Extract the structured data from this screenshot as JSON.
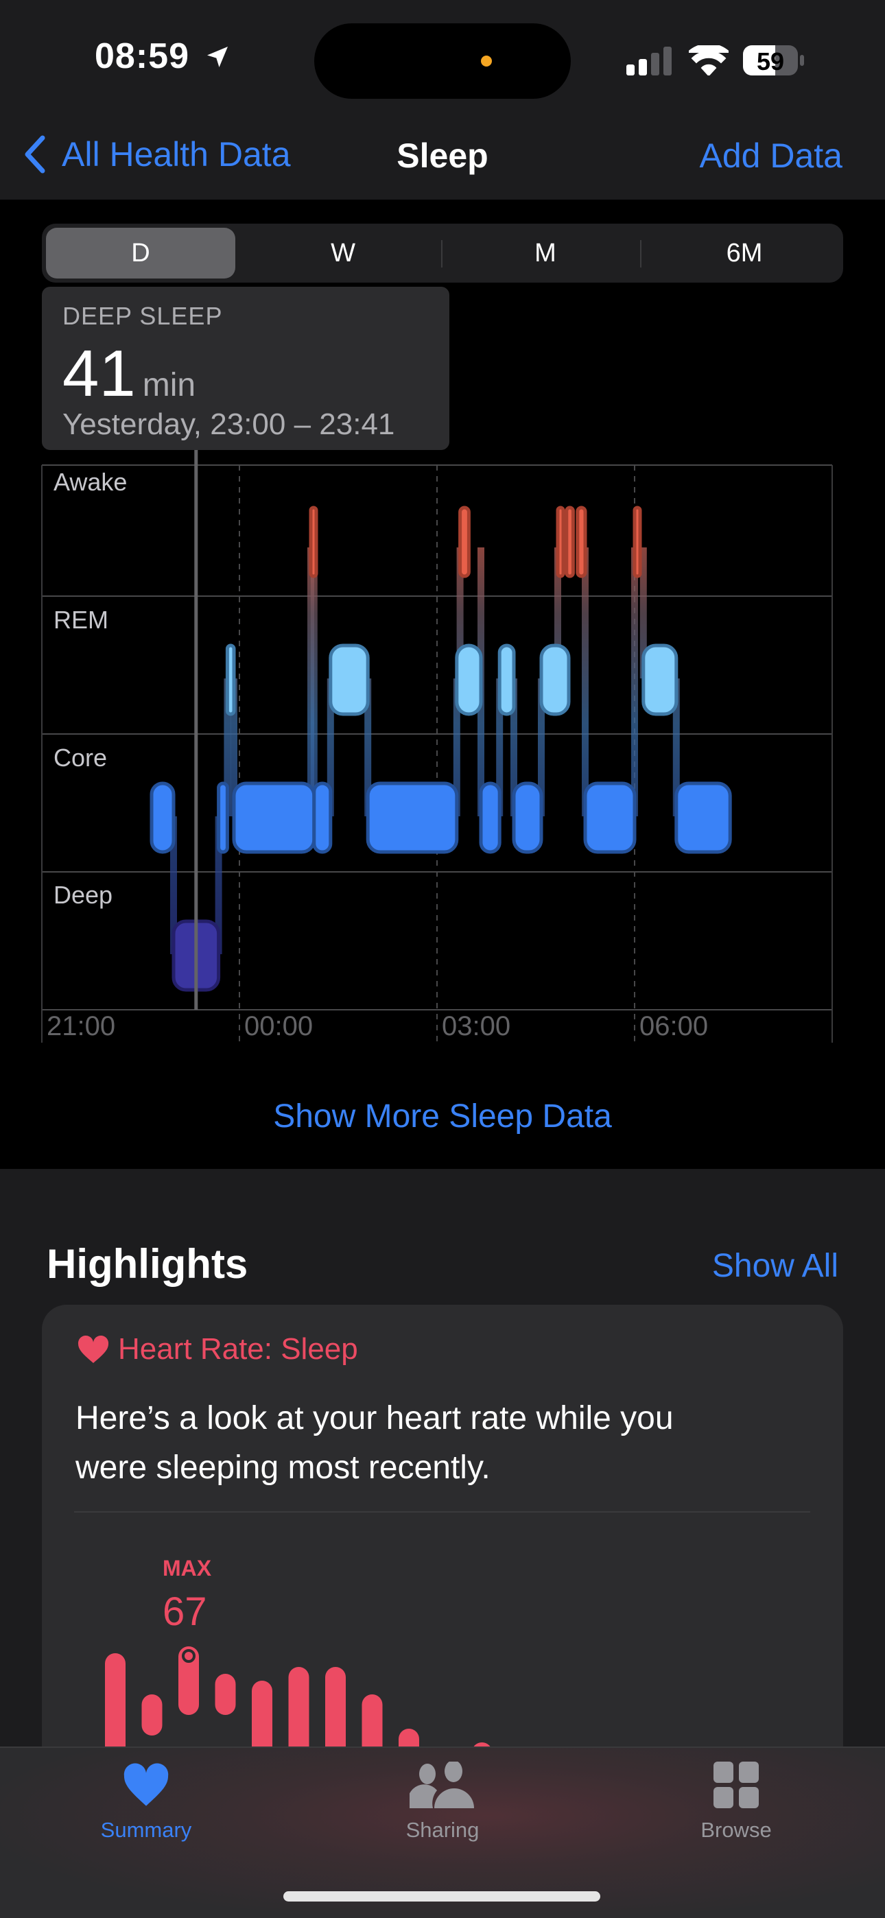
{
  "status_bar": {
    "time": "08:59",
    "battery": "59",
    "icons": [
      "location-arrow-icon",
      "cellular-signal-icon",
      "wifi-icon",
      "battery-icon"
    ]
  },
  "nav": {
    "back_label": "All Health Data",
    "title": "Sleep",
    "action_label": "Add Data"
  },
  "segments": {
    "options": [
      "D",
      "W",
      "M",
      "6M"
    ],
    "selected": "D"
  },
  "tooltip": {
    "label": "DEEP SLEEP",
    "value": "41",
    "unit": "min",
    "range": "Yesterday, 23:00 – 23:41"
  },
  "sleep_chart": {
    "type": "timeline",
    "stages": [
      "Awake",
      "REM",
      "Core",
      "Deep"
    ],
    "x_ticks": [
      "21:00",
      "00:00",
      "03:00",
      "06:00"
    ],
    "x_range": [
      "21:00",
      "09:00"
    ],
    "selected_segment": {
      "stage": "Deep",
      "start": "23:00",
      "end": "23:41"
    },
    "colors": {
      "Awake": "#e8604a",
      "REM": "#84cffb",
      "Core": "#3a82f7",
      "Deep": "#3a35a0"
    },
    "segments": [
      {
        "stage": "Core",
        "start": "22:40",
        "end": "23:00"
      },
      {
        "stage": "Deep",
        "start": "23:00",
        "end": "23:41"
      },
      {
        "stage": "Core",
        "start": "23:41",
        "end": "23:49"
      },
      {
        "stage": "REM",
        "start": "23:49",
        "end": "23:55"
      },
      {
        "stage": "Core",
        "start": "23:55",
        "end": "01:08"
      },
      {
        "stage": "Awake",
        "start": "01:05",
        "end": "01:10"
      },
      {
        "stage": "Core",
        "start": "01:08",
        "end": "01:23"
      },
      {
        "stage": "REM",
        "start": "01:23",
        "end": "01:57"
      },
      {
        "stage": "Core",
        "start": "01:57",
        "end": "03:18"
      },
      {
        "stage": "REM",
        "start": "03:18",
        "end": "03:40"
      },
      {
        "stage": "Awake",
        "start": "03:21",
        "end": "03:29"
      },
      {
        "stage": "Core",
        "start": "03:40",
        "end": "03:57"
      },
      {
        "stage": "REM",
        "start": "03:57",
        "end": "04:10"
      },
      {
        "stage": "Core",
        "start": "04:10",
        "end": "04:35"
      },
      {
        "stage": "REM",
        "start": "04:35",
        "end": "05:00"
      },
      {
        "stage": "Awake",
        "start": "04:50",
        "end": "04:55"
      },
      {
        "stage": "Awake",
        "start": "04:58",
        "end": "05:04"
      },
      {
        "stage": "Awake",
        "start": "05:08",
        "end": "05:15"
      },
      {
        "stage": "Core",
        "start": "05:15",
        "end": "06:00"
      },
      {
        "stage": "Awake",
        "start": "06:00",
        "end": "06:04"
      },
      {
        "stage": "REM",
        "start": "06:08",
        "end": "06:38"
      },
      {
        "stage": "Core",
        "start": "06:38",
        "end": "07:27"
      }
    ]
  },
  "show_more_label": "Show More Sleep Data",
  "highlights": {
    "title": "Highlights",
    "show_all_label": "Show All",
    "card": {
      "title": "Heart Rate: Sleep",
      "lines": [
        "Here’s a look at your heart rate while you",
        "were sleeping most recently."
      ],
      "max_label": "MAX",
      "max_value": "67",
      "accent": "#ec4b63",
      "chart_data": {
        "type": "range-bar",
        "unit": "bpm",
        "highlight_index": 2,
        "ranges": [
          [
            50,
            66
          ],
          [
            54,
            60
          ],
          [
            57,
            67
          ],
          [
            57,
            63
          ],
          [
            50,
            62
          ],
          [
            50,
            64
          ],
          [
            50,
            64
          ],
          [
            50,
            60
          ],
          [
            50,
            55
          ],
          [
            50,
            53
          ]
        ]
      }
    }
  },
  "tab_bar": {
    "items": [
      {
        "label": "Summary",
        "icon": "heart-icon",
        "active": true
      },
      {
        "label": "Sharing",
        "icon": "people-icon",
        "active": false
      },
      {
        "label": "Browse",
        "icon": "grid-icon",
        "active": false
      }
    ],
    "active_color": "#3a82f7",
    "inactive_color": "#98989d"
  }
}
